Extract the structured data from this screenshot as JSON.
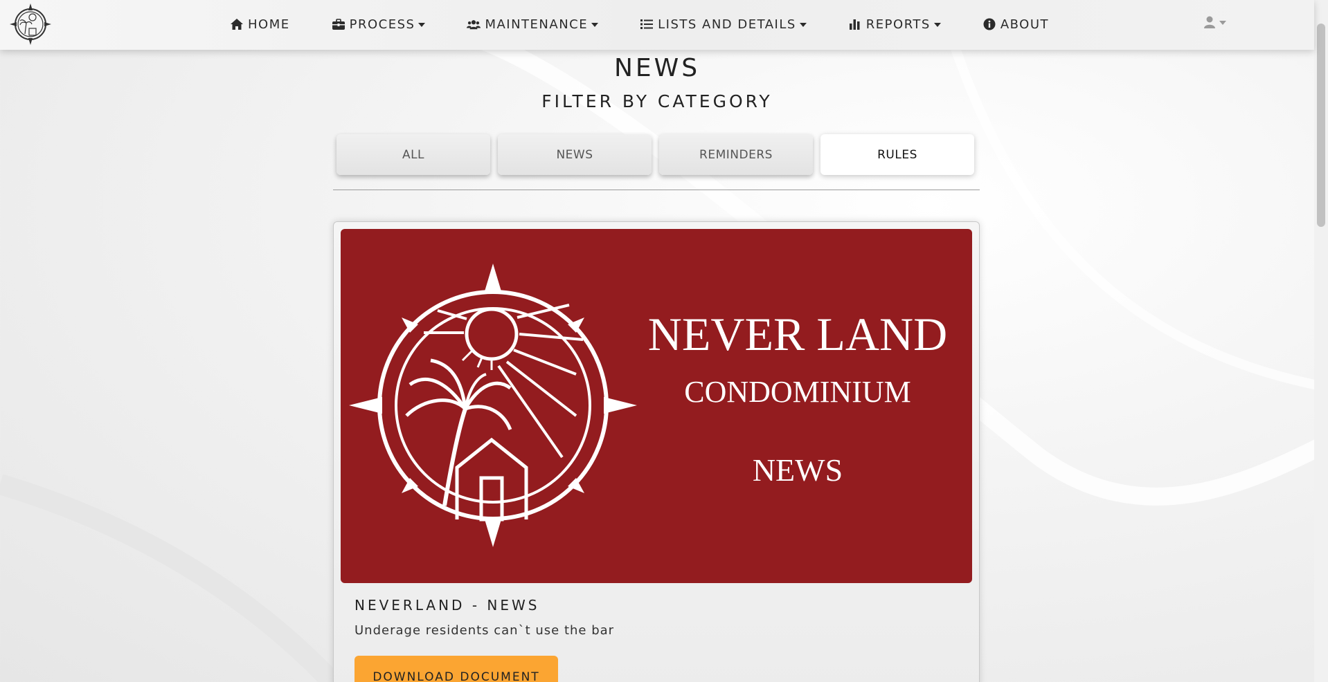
{
  "nav": {
    "items": [
      {
        "label": "HOME",
        "icon": "home-icon",
        "dropdown": false
      },
      {
        "label": "PROCESS",
        "icon": "toolbox-icon",
        "dropdown": true
      },
      {
        "label": "MAINTENANCE",
        "icon": "users-icon",
        "dropdown": true
      },
      {
        "label": "LISTS AND DETAILS",
        "icon": "list-icon",
        "dropdown": true
      },
      {
        "label": "REPORTS",
        "icon": "bar-chart-icon",
        "dropdown": true
      },
      {
        "label": "ABOUT",
        "icon": "info-circle-icon",
        "dropdown": false
      }
    ],
    "user_icon": "user-icon"
  },
  "page": {
    "title": "NEWS",
    "subtitle": "FILTER BY CATEGORY"
  },
  "filters": {
    "options": [
      "ALL",
      "NEWS",
      "REMINDERS",
      "RULES"
    ],
    "active": "RULES"
  },
  "card": {
    "banner": {
      "line1": "NEVER LAND",
      "line2": "CONDOMINIUM",
      "line3": "NEWS",
      "background": "#931c1f"
    },
    "title": "NEVERLAND - NEWS",
    "text": "Underage residents can`t use the bar",
    "button_label": "DOWNLOAD DOCUMENT",
    "button_color": "#fba532"
  }
}
